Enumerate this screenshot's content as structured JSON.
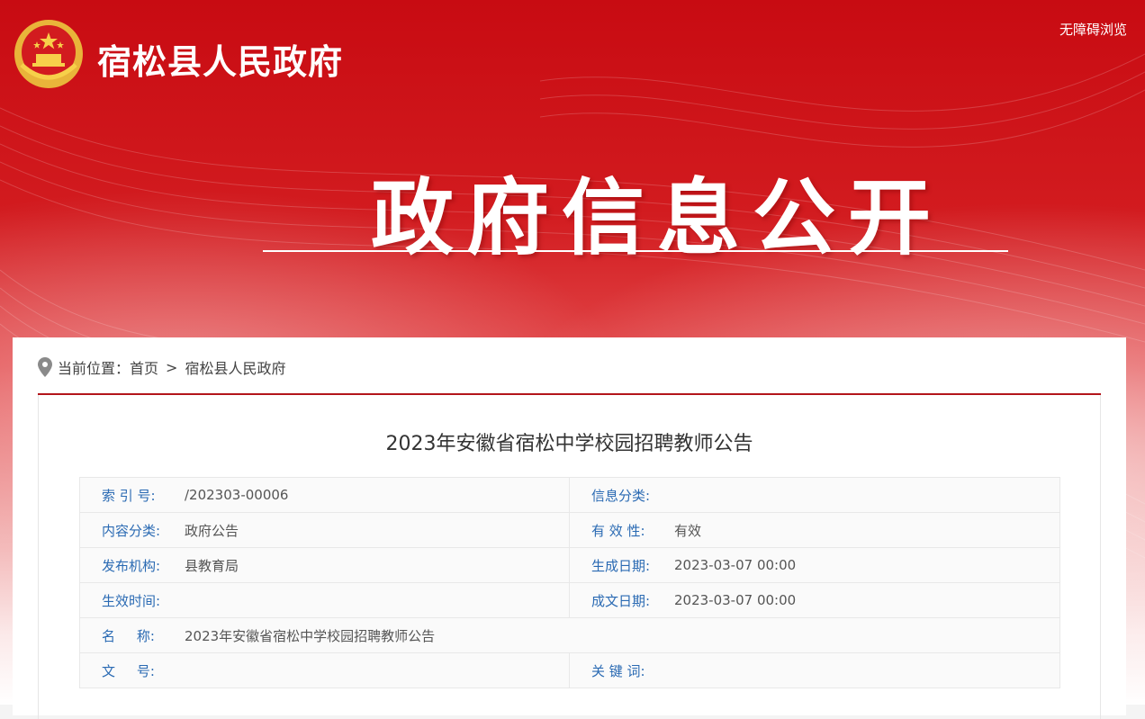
{
  "header": {
    "site_title": "宿松县人民政府",
    "accessibility_label": "无障碍浏览",
    "banner_heading": "政府信息公开"
  },
  "breadcrumb": {
    "prefix": "当前位置：",
    "items": [
      "首页",
      "宿松县人民政府"
    ],
    "separator": ">"
  },
  "article": {
    "title": "2023年安徽省宿松中学校园招聘教师公告"
  },
  "meta": {
    "index_label": "索 引 号:",
    "index_value": "/202303-00006",
    "info_category_label": "信息分类:",
    "info_category_value": "",
    "content_category_label": "内容分类:",
    "content_category_value": "政府公告",
    "validity_label": "有 效 性:",
    "validity_value": "有效",
    "issuer_label": "发布机构:",
    "issuer_value": "县教育局",
    "generated_date_label": "生成日期:",
    "generated_date_value": "2023-03-07 00:00",
    "effective_time_label": "生效时间:",
    "effective_time_value": "",
    "written_date_label": "成文日期:",
    "written_date_value": "2023-03-07 00:00",
    "name_label": "名     称:",
    "name_value": "2023年安徽省宿松中学校园招聘教师公告",
    "doc_no_label": "文     号:",
    "doc_no_value": "",
    "keywords_label": "关 键 词:",
    "keywords_value": ""
  },
  "colors": {
    "brand_red": "#c80b12",
    "label_blue": "#2a6ab3",
    "divider_red": "#b3151b"
  }
}
